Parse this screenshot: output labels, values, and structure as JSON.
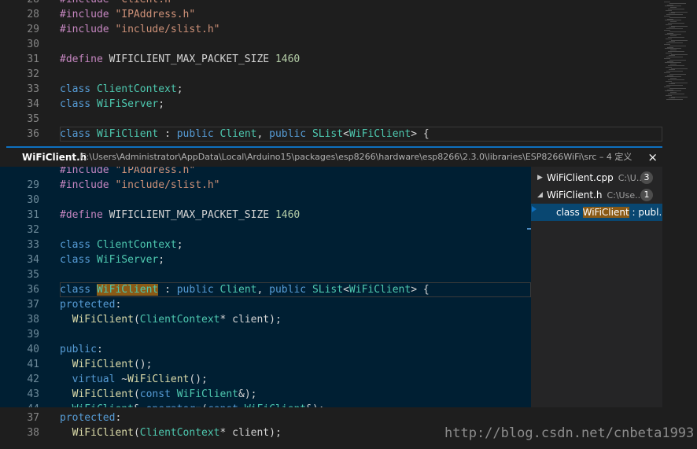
{
  "editor_top": {
    "lines": [
      {
        "num": "28",
        "text": "#include \"Client.h\""
      },
      {
        "num": "28",
        "text": "#include \"IPAddress.h\""
      },
      {
        "num": "29",
        "text": "#include \"include/slist.h\""
      },
      {
        "num": "30",
        "text": ""
      },
      {
        "num": "31",
        "text": "#define WIFICLIENT_MAX_PACKET_SIZE 1460"
      },
      {
        "num": "32",
        "text": ""
      },
      {
        "num": "33",
        "text": "class ClientContext;"
      },
      {
        "num": "34",
        "text": "class WiFiServer;"
      },
      {
        "num": "35",
        "text": ""
      },
      {
        "num": "36",
        "text": "class WiFiClient : public Client, public SList<WiFiClient> {"
      }
    ]
  },
  "peek": {
    "title": "WiFiClient.h",
    "path": "C:\\Users\\Administrator\\AppData\\Local\\Arduino15\\packages\\esp8266\\hardware\\esp8266\\2.3.0\\libraries\\ESP8266WiFi\\src – 4 定义",
    "close_label": "×",
    "lines": [
      {
        "num": "",
        "text": "#include \"IPAddress.h\""
      },
      {
        "num": "29",
        "text": "#include \"include/slist.h\""
      },
      {
        "num": "30",
        "text": ""
      },
      {
        "num": "31",
        "text": "#define WIFICLIENT_MAX_PACKET_SIZE 1460"
      },
      {
        "num": "32",
        "text": ""
      },
      {
        "num": "33",
        "text": "class ClientContext;"
      },
      {
        "num": "34",
        "text": "class WiFiServer;"
      },
      {
        "num": "35",
        "text": ""
      },
      {
        "num": "36",
        "text": "class WiFiClient : public Client, public SList<WiFiClient> {"
      },
      {
        "num": "37",
        "text": "protected:"
      },
      {
        "num": "38",
        "text": "  WiFiClient(ClientContext* client);"
      },
      {
        "num": "39",
        "text": ""
      },
      {
        "num": "40",
        "text": "public:"
      },
      {
        "num": "41",
        "text": "  WiFiClient();"
      },
      {
        "num": "42",
        "text": "  virtual ~WiFiClient();"
      },
      {
        "num": "43",
        "text": "  WiFiClient(const WiFiClient&);"
      },
      {
        "num": "44",
        "text": "  WiFiClient& operator=(const WiFiClient&);"
      }
    ],
    "tree": {
      "files": [
        {
          "name": "WiFiClient.cpp",
          "loc": "C:\\U...",
          "count": "3",
          "expanded": false
        },
        {
          "name": "WiFiClient.h",
          "loc": "C:\\Use...",
          "count": "1",
          "expanded": true
        }
      ],
      "reference": {
        "prefix": "class ",
        "match": "WiFiClient",
        "suffix": " : publ..."
      }
    }
  },
  "editor_bottom": {
    "lines": [
      {
        "num": "37",
        "text": "protected:"
      },
      {
        "num": "38",
        "text": "  WiFiClient(ClientContext* client);"
      }
    ]
  },
  "watermark": "http://blog.csdn.net/cnbeta1993",
  "colors": {
    "keyword": "#569cd6",
    "type": "#4ec9b0",
    "string": "#ce9178",
    "function": "#dcdcaa",
    "number": "#b5cea8",
    "directive": "#c586c0",
    "peek_accent": "#0e70c0",
    "peek_background": "#001f33",
    "match_highlight": "#8a5a16"
  }
}
